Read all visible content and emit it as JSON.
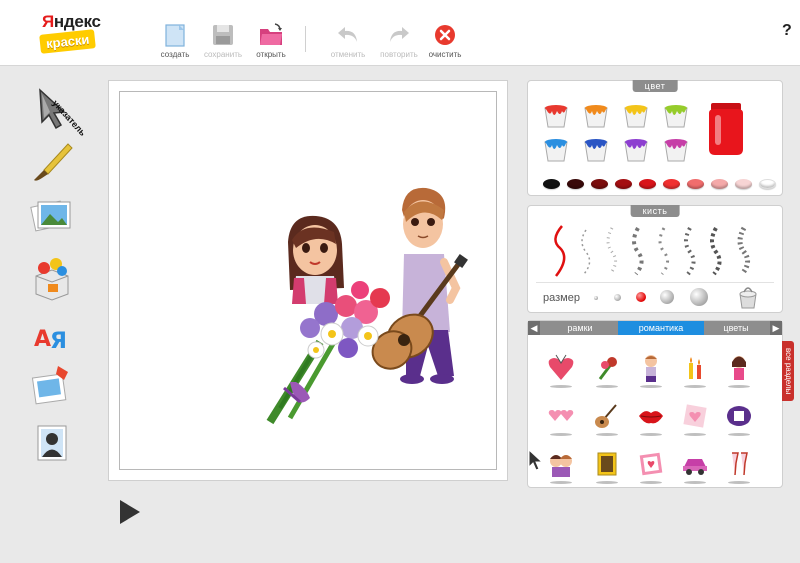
{
  "logo": {
    "line1_red": "Я",
    "line1_rest": "ндекс",
    "line2": "краски"
  },
  "toolbar": {
    "create_label": "создать",
    "save_label": "сохранить",
    "open_label": "открыть",
    "undo_label": "отменить",
    "redo_label": "повторить",
    "clear_label": "очистить",
    "help_label": "?"
  },
  "tools": {
    "pointer_label": "указатель"
  },
  "color_panel": {
    "title": "цвет",
    "buckets": [
      "#e8392f",
      "#f08a1c",
      "#f3c419",
      "#96cc2b",
      "#2b8fe0",
      "#2a55c4",
      "#8d3fd0",
      "#c63fa7"
    ],
    "jar_color": "#e8151c",
    "swatches": [
      "#111111",
      "#3a0a0a",
      "#7a0d0d",
      "#a40f12",
      "#d8141a",
      "#f03030",
      "#f06d6d",
      "#f4a9a9",
      "#f7d4d4",
      "#ffffff"
    ]
  },
  "brush_panel": {
    "title": "кисть",
    "size_label": "размер"
  },
  "sticker_panel": {
    "tabs": {
      "prev": "◀",
      "frames": "рамки",
      "romance": "романтика",
      "flowers": "цветы",
      "next": "▶"
    },
    "all_sections": "все разделы"
  }
}
